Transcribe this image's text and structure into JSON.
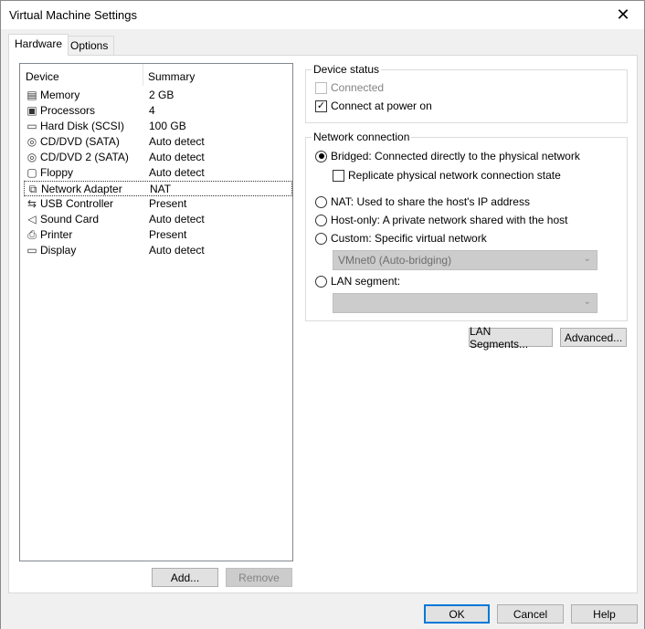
{
  "window": {
    "title": "Virtual Machine Settings",
    "close_glyph": "✕"
  },
  "tabs": [
    {
      "label": "Hardware",
      "active": true
    },
    {
      "label": "Options",
      "active": false
    }
  ],
  "device_list": {
    "columns": [
      "Device",
      "Summary"
    ],
    "rows": [
      {
        "icon": "memory-icon",
        "name": "Memory",
        "summary": "2 GB"
      },
      {
        "icon": "processor-icon",
        "name": "Processors",
        "summary": "4"
      },
      {
        "icon": "hard-disk-icon",
        "name": "Hard Disk (SCSI)",
        "summary": "100 GB"
      },
      {
        "icon": "cd-dvd-icon",
        "name": "CD/DVD (SATA)",
        "summary": "Auto detect"
      },
      {
        "icon": "cd-dvd-icon",
        "name": "CD/DVD 2 (SATA)",
        "summary": "Auto detect"
      },
      {
        "icon": "floppy-icon",
        "name": "Floppy",
        "summary": "Auto detect"
      },
      {
        "icon": "network-adapter-icon",
        "name": "Network Adapter",
        "summary": "NAT",
        "selected": true
      },
      {
        "icon": "usb-icon",
        "name": "USB Controller",
        "summary": "Present"
      },
      {
        "icon": "speaker-icon",
        "name": "Sound Card",
        "summary": "Auto detect"
      },
      {
        "icon": "printer-icon",
        "name": "Printer",
        "summary": "Present"
      },
      {
        "icon": "display-icon",
        "name": "Display",
        "summary": "Auto detect"
      }
    ]
  },
  "list_buttons": {
    "add": "Add...",
    "remove": "Remove"
  },
  "device_status": {
    "title": "Device status",
    "connected": {
      "label": "Connected",
      "checked": false,
      "disabled": true
    },
    "connect_power_on": {
      "label": "Connect at power on",
      "checked": true
    }
  },
  "network_connection": {
    "title": "Network connection",
    "bridged": {
      "label": "Bridged: Connected directly to the physical network",
      "selected": true
    },
    "replicate": {
      "label": "Replicate physical network connection state",
      "checked": false
    },
    "nat": {
      "label": "NAT: Used to share the host's IP address",
      "selected": false
    },
    "host_only": {
      "label": "Host-only: A private network shared with the host",
      "selected": false
    },
    "custom": {
      "label": "Custom: Specific virtual network",
      "selected": false
    },
    "custom_select": "VMnet0 (Auto-bridging)",
    "lan_segment": {
      "label": "LAN segment:",
      "selected": false
    },
    "lan_select": ""
  },
  "network_buttons": {
    "lan_segments": "LAN Segments...",
    "advanced": "Advanced..."
  },
  "dialog_buttons": {
    "ok": "OK",
    "cancel": "Cancel",
    "help": "Help"
  },
  "icons": {
    "memory-icon": "▤",
    "processor-icon": "▣",
    "hard-disk-icon": "▭",
    "cd-dvd-icon": "◎",
    "floppy-icon": "▢",
    "network-adapter-icon": "⧉",
    "usb-icon": "⇆",
    "speaker-icon": "◁",
    "printer-icon": "⎙",
    "display-icon": "▭"
  }
}
